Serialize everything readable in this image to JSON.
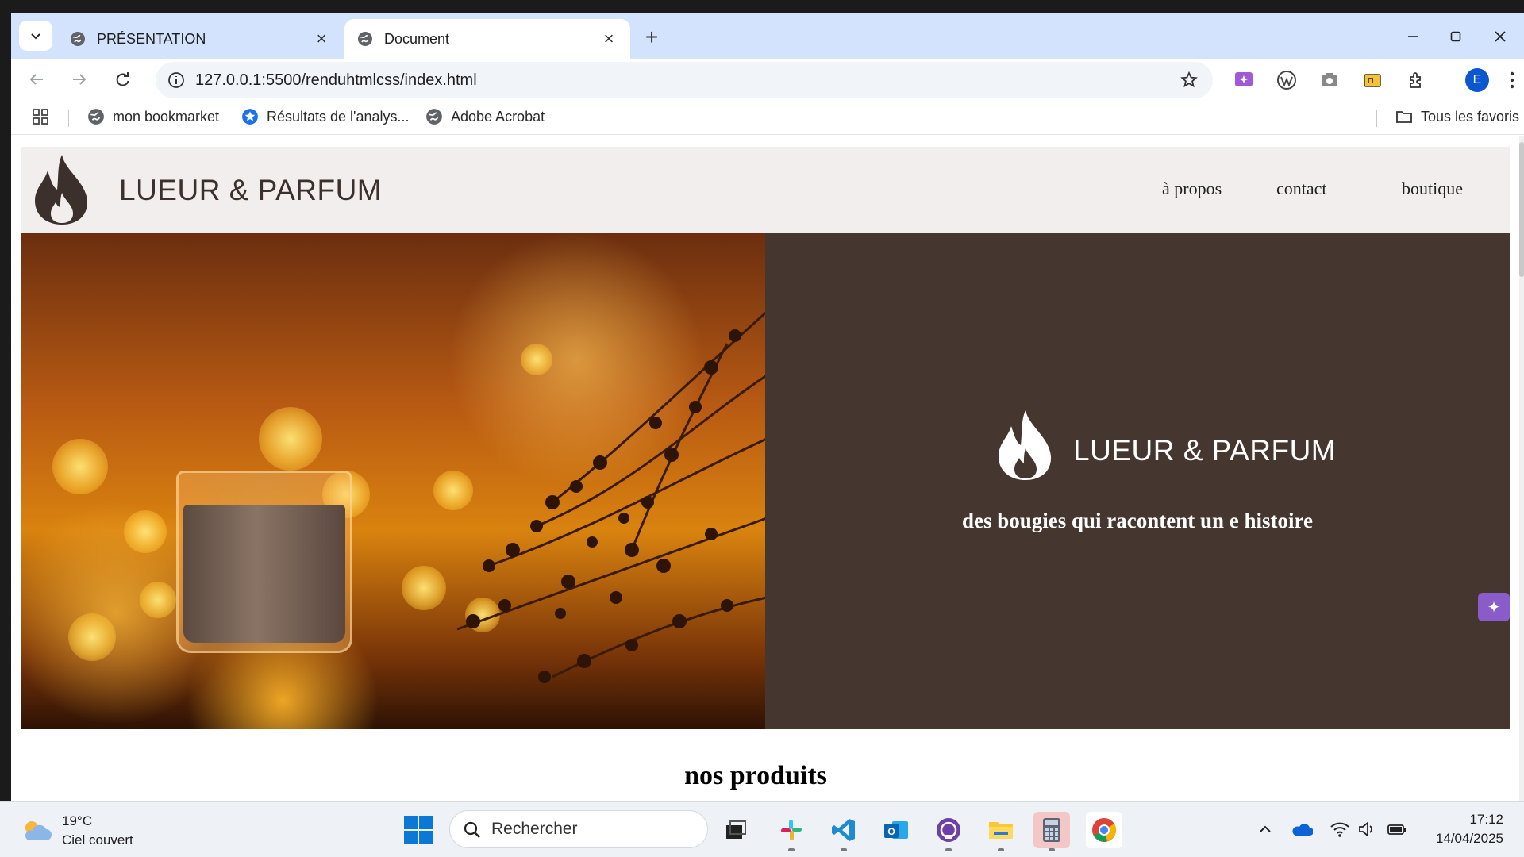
{
  "browser": {
    "tabs": [
      {
        "title": "PRÉSENTATION",
        "active": false
      },
      {
        "title": "Document",
        "active": true
      }
    ],
    "url": "127.0.0.1:5500/renduhtmlcss/index.html",
    "profile_initial": "E",
    "bookmarks": [
      {
        "label": "mon bookmarket",
        "icon": "globe-icon"
      },
      {
        "label": "Résultats de l'analys...",
        "icon": "star-badge-icon"
      },
      {
        "label": "Adobe Acrobat",
        "icon": "globe-icon"
      }
    ],
    "all_bookmarks_label": "Tous les favoris"
  },
  "site": {
    "brand": "LUEUR & PARFUM",
    "nav": [
      "à propos",
      "contact",
      "boutique"
    ],
    "hero": {
      "brand": "LUEUR & PARFUM",
      "tagline": "des bougies qui racontent un e histoire"
    },
    "products_title": "nos produits",
    "colors": {
      "header_bg": "#f2eeed",
      "panel_bg": "#45362f",
      "text_dark": "#3b302b"
    }
  },
  "taskbar": {
    "weather_temp": "19°C",
    "weather_desc": "Ciel couvert",
    "search_placeholder": "Rechercher",
    "time": "17:12",
    "date": "14/04/2025"
  }
}
